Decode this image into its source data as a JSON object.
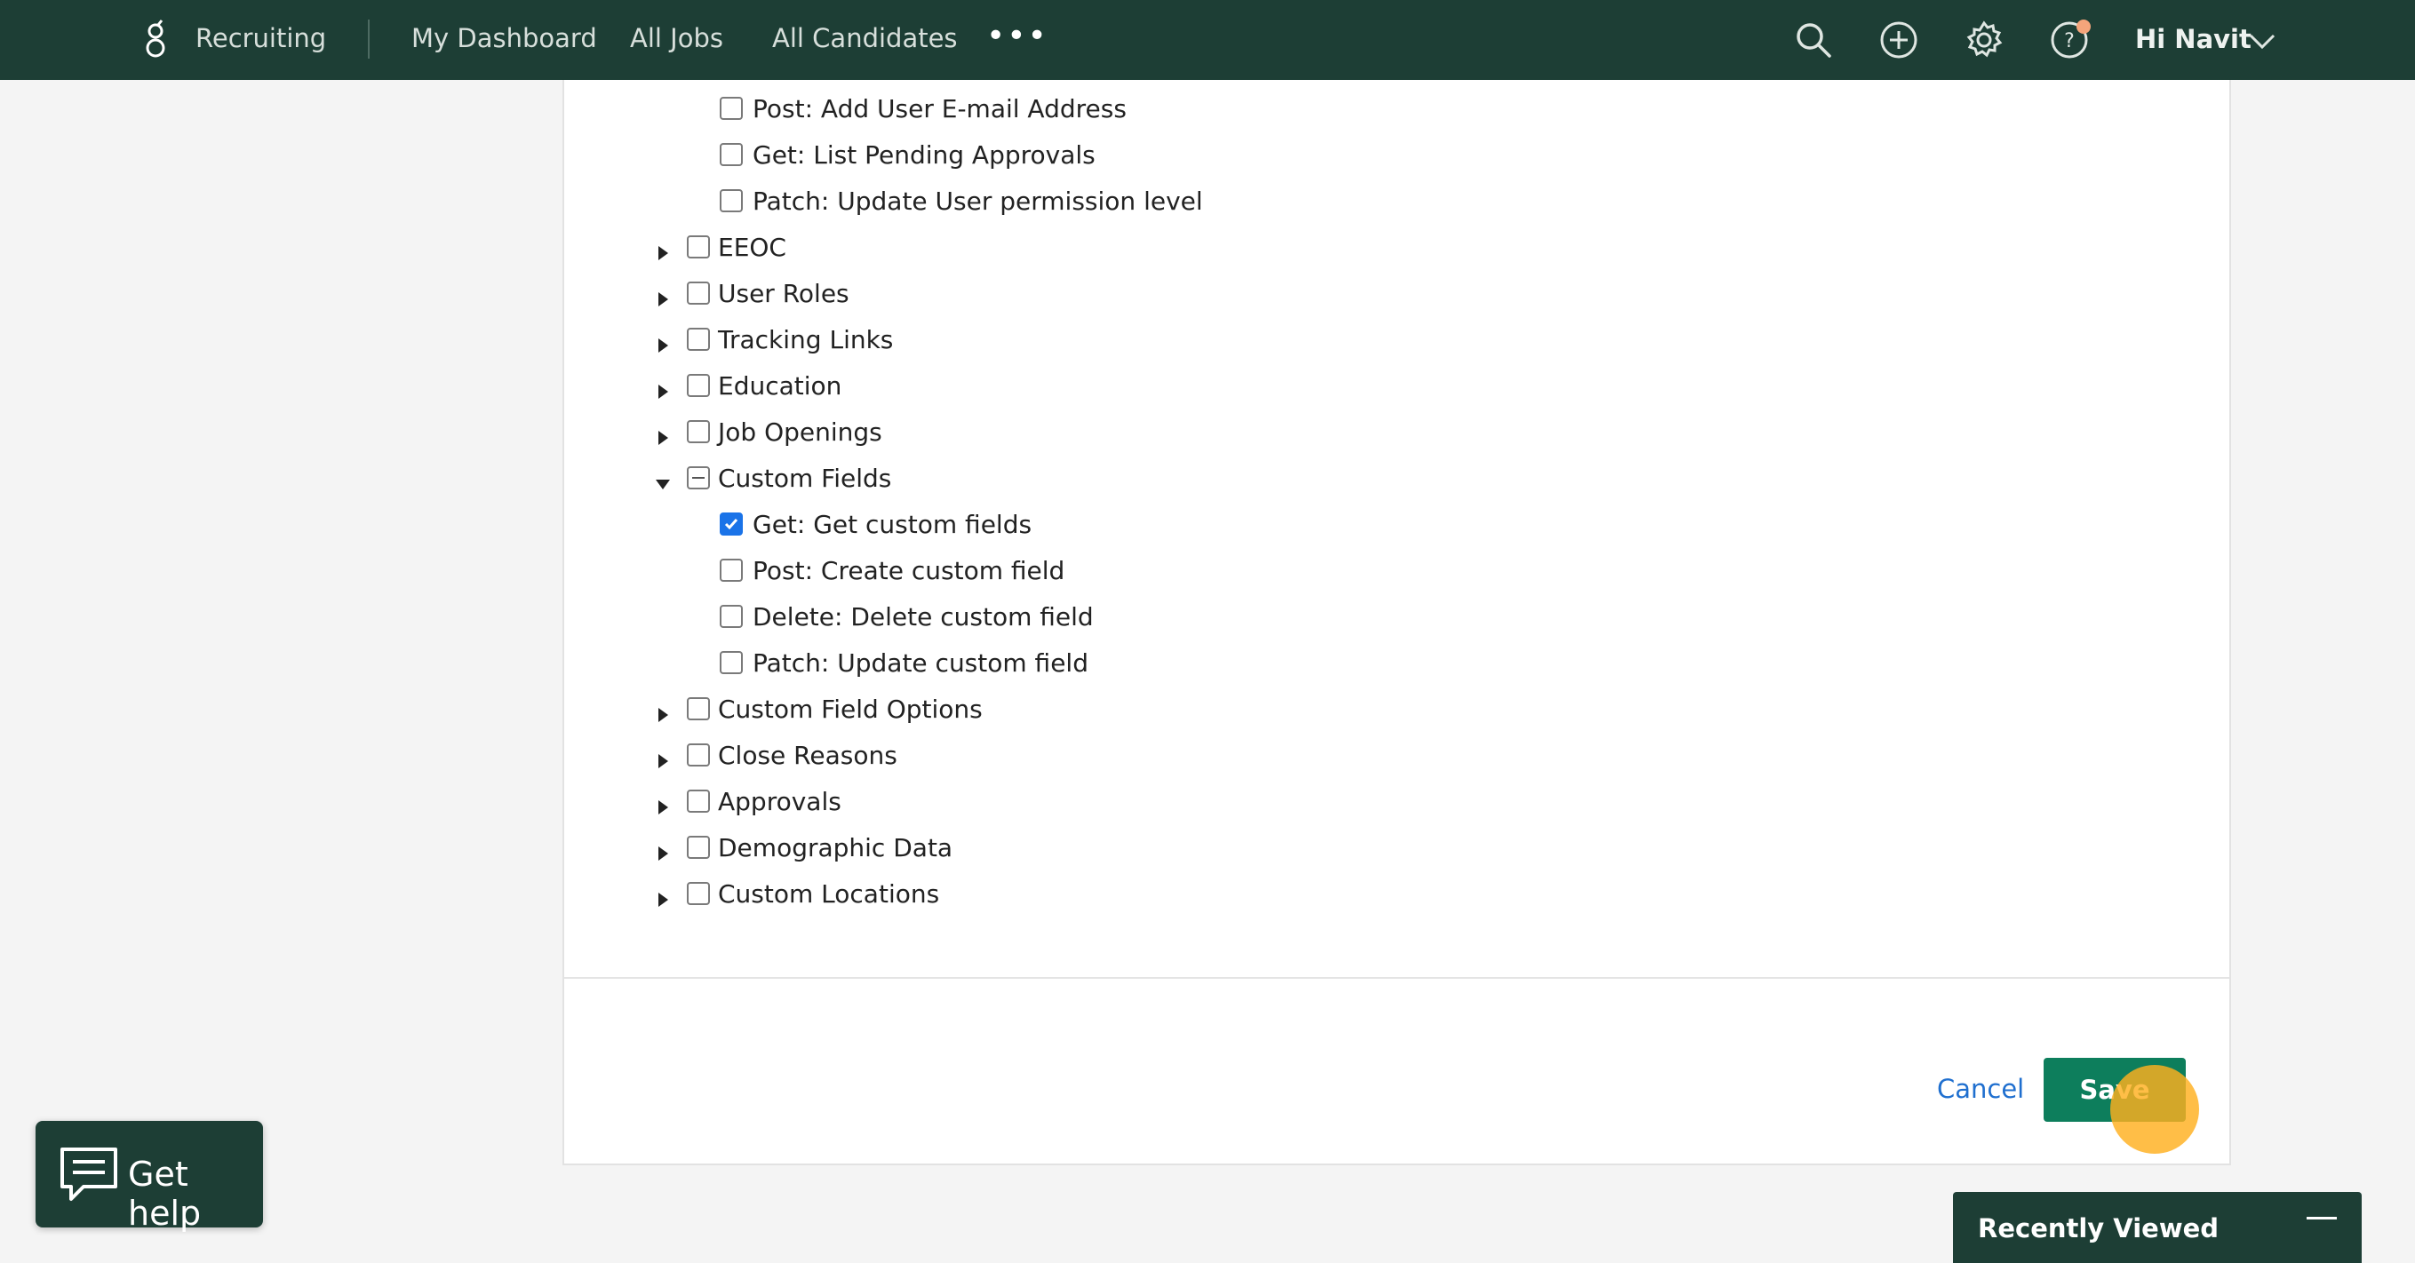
{
  "header": {
    "brand": "Recruiting",
    "nav": [
      {
        "label": "My Dashboard"
      },
      {
        "label": "All Jobs"
      },
      {
        "label": "All Candidates"
      }
    ],
    "more": "•••",
    "greeting": "Hi Navit",
    "icons": [
      "search-icon",
      "add-circle-icon",
      "settings-gear-icon",
      "help-question-icon",
      "chevron-down-icon"
    ]
  },
  "permissions": [
    {
      "label": "Post: Add User E-mail Address",
      "level": "child",
      "checked": false
    },
    {
      "label": "Get: List Pending Approvals",
      "level": "child",
      "checked": false
    },
    {
      "label": "Patch: Update User permission level",
      "level": "child",
      "checked": false
    },
    {
      "label": "EEOC",
      "level": "group",
      "expanded": false,
      "checked": false
    },
    {
      "label": "User Roles",
      "level": "group",
      "expanded": false,
      "checked": false
    },
    {
      "label": "Tracking Links",
      "level": "group",
      "expanded": false,
      "checked": false
    },
    {
      "label": "Education",
      "level": "group",
      "expanded": false,
      "checked": false
    },
    {
      "label": "Job Openings",
      "level": "group",
      "expanded": false,
      "checked": false
    },
    {
      "label": "Custom Fields",
      "level": "group",
      "expanded": true,
      "checked": "partial"
    },
    {
      "label": "Get: Get custom fields",
      "level": "child",
      "checked": true
    },
    {
      "label": "Post: Create custom field",
      "level": "child",
      "checked": false
    },
    {
      "label": "Delete: Delete custom field",
      "level": "child",
      "checked": false
    },
    {
      "label": "Patch: Update custom field",
      "level": "child",
      "checked": false
    },
    {
      "label": "Custom Field Options",
      "level": "group",
      "expanded": false,
      "checked": false
    },
    {
      "label": "Close Reasons",
      "level": "group",
      "expanded": false,
      "checked": false
    },
    {
      "label": "Approvals",
      "level": "group",
      "expanded": false,
      "checked": false
    },
    {
      "label": "Demographic Data",
      "level": "group",
      "expanded": false,
      "checked": false
    },
    {
      "label": "Custom Locations",
      "level": "group",
      "expanded": false,
      "checked": false
    }
  ],
  "footer": {
    "cancel_label": "Cancel",
    "save_label": "Save"
  },
  "help_widget": {
    "label": "Get help",
    "icon": "chat-icon"
  },
  "recently_viewed": {
    "title": "Recently Viewed"
  },
  "colors": {
    "header_bg": "#1d3e35",
    "save_bg": "#0d7e5c",
    "link": "#1f6fcf",
    "checkbox_checked": "#1a73e8",
    "click_indicator": "#ffb01e"
  }
}
